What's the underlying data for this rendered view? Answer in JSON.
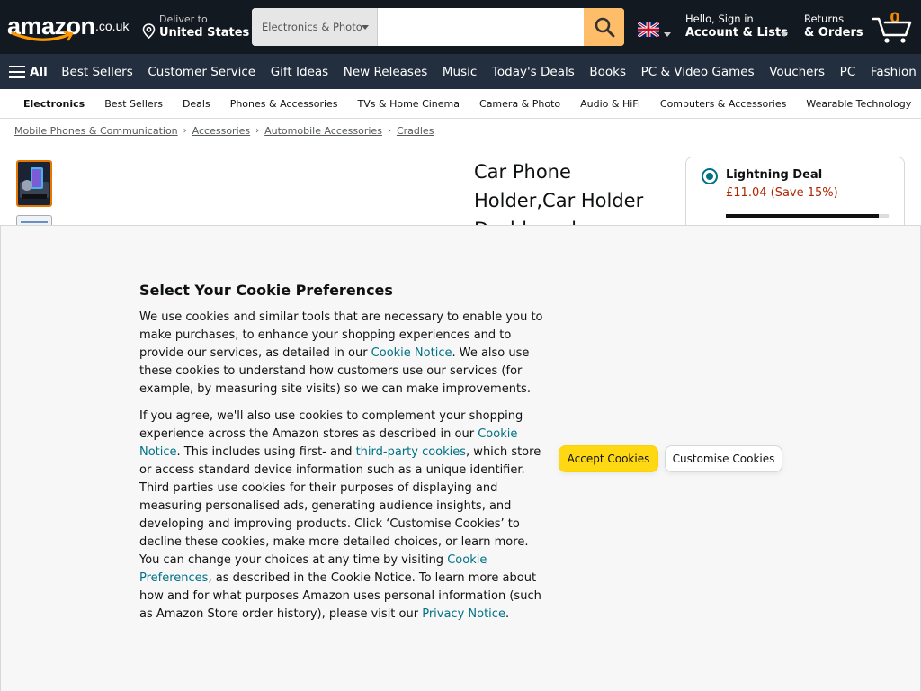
{
  "header": {
    "logo_text": "amazon",
    "logo_tld": ".co.uk",
    "deliver_line1": "Deliver to",
    "deliver_line2": "United States",
    "search_category": "Electronics & Photo",
    "search_placeholder": "",
    "account_line1": "Hello, Sign in",
    "account_line2": "Account & Lists",
    "returns_line1": "Returns",
    "returns_line2": "& Orders",
    "cart_count": "0"
  },
  "nav": {
    "all_label": "All",
    "links": [
      "Best Sellers",
      "Customer Service",
      "Gift Ideas",
      "New Releases",
      "Music",
      "Today's Deals",
      "Books",
      "PC & Video Games",
      "Vouchers",
      "PC",
      "Fashion"
    ]
  },
  "subnav": {
    "links": [
      "Electronics",
      "Best Sellers",
      "Deals",
      "Phones & Accessories",
      "TVs & Home Cinema",
      "Camera & Photo",
      "Audio & HiFi",
      "Computers & Accessories",
      "Wearable Technology"
    ]
  },
  "breadcrumb": [
    "Mobile Phones & Communication",
    "Accessories",
    "Automobile Accessories",
    "Cradles"
  ],
  "product": {
    "title": "Car Phone Holder,Car Holder Dashboard"
  },
  "deal": {
    "title": "Lightning Deal",
    "price": "£11.04 (Save 15%)",
    "claimed_fraction": 0.94
  },
  "cookie": {
    "heading": "Select Your Cookie Preferences",
    "p1_a": "We use cookies and similar tools that are necessary to enable you to make purchases, to enhance your shopping experiences and to provide our services, as detailed in our ",
    "p1_link": "Cookie Notice",
    "p1_b": ". We also use these cookies to understand how customers use our services (for example, by measuring site visits) so we can make improvements.",
    "p2_a": "If you agree, we'll also use cookies to complement your shopping experience across the Amazon stores as described in our ",
    "p2_link1": "Cookie Notice",
    "p2_b": ". This includes using first- and ",
    "p2_link2": "third-party cookies",
    "p2_c": ", which store or access standard device information such as a unique identifier. Third parties use cookies for their purposes of displaying and measuring personalised ads, generating audience insights, and developing and improving products. Click ‘Customise Cookies’ to decline these cookies, make more detailed choices, or learn more. You can change your choices at any time by visiting ",
    "p2_link3": "Cookie Preferences",
    "p2_d": ", as described in the Cookie Notice. To learn more about how and for what purposes Amazon uses personal information (such as Amazon Store order history), please visit our ",
    "p2_link4": "Privacy Notice",
    "p2_e": ".",
    "accept_label": "Accept Cookies",
    "customise_label": "Customise Cookies"
  },
  "colors": {
    "header_bg": "#131921",
    "nav_bg": "#232f3e",
    "search_button": "#febd69",
    "cart_count": "#f08804",
    "link": "#007185",
    "price": "#b12704",
    "accept_button": "#ffd814"
  }
}
